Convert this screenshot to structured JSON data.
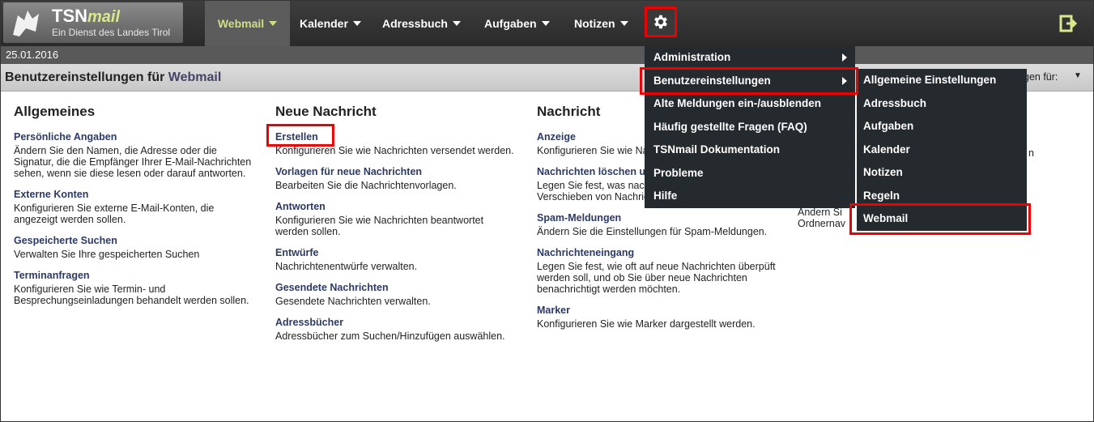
{
  "brand": {
    "name": "TSN",
    "name_suffix": "mail",
    "subtitle": "Ein Dienst des Landes Tirol"
  },
  "nav": {
    "webmail": "Webmail",
    "kalender": "Kalender",
    "adressbuch": "Adressbuch",
    "aufgaben": "Aufgaben",
    "notizen": "Notizen"
  },
  "date": "25.01.2016",
  "page_title": {
    "prefix": "Benutzereinstellungen für ",
    "app": "Webmail"
  },
  "right_partial": "gen für:",
  "columns": {
    "allgemeines": {
      "title": "Allgemeines",
      "sections": [
        {
          "h": "Persönliche Angaben",
          "d": "Ändern Sie den Namen, die Adresse oder die Signatur, die die Empfänger Ihrer E-Mail-Nachrichten sehen, wenn sie diese lesen oder darauf antworten."
        },
        {
          "h": "Externe Konten",
          "d": "Konfigurieren Sie externe E-Mail-Konten, die angezeigt werden sollen."
        },
        {
          "h": "Gespeicherte Suchen",
          "d": "Verwalten Sie Ihre gespeicherten Suchen"
        },
        {
          "h": "Terminanfragen",
          "d": "Konfigurieren Sie wie Termin- und Besprechungseinladungen behandelt werden sollen."
        }
      ]
    },
    "neue": {
      "title": "Neue Nachricht",
      "sections": [
        {
          "h": "Erstellen",
          "d": "Konfigurieren Sie wie Nachrichten versendet werden."
        },
        {
          "h": "Vorlagen für neue Nachrichten",
          "d": "Bearbeiten Sie die Nachrichtenvorlagen."
        },
        {
          "h": "Antworten",
          "d": "Konfigurieren Sie wie Nachrichten beantwortet werden sollen."
        },
        {
          "h": "Entwürfe",
          "d": "Nachrichtenentwürfe verwalten."
        },
        {
          "h": "Gesendete Nachrichten",
          "d": "Gesendete Nachrichten verwalten."
        },
        {
          "h": "Adressbücher",
          "d": "Adressbücher zum Suchen/Hinzufügen auswählen."
        }
      ]
    },
    "nachricht": {
      "title": "Nachricht",
      "sections": [
        {
          "h": "Anzeige",
          "d": "Konfigurieren Sie wie Nachrichten angezeigt werden."
        },
        {
          "h": "Nachrichten löschen und verschieben",
          "d": "Legen Sie fest, was nach dem Löschen und Verschieben von Nachrichten passieren soll."
        },
        {
          "h": "Spam-Meldungen",
          "d": "Ändern Sie die Einstellungen für Spam-Meldungen."
        },
        {
          "h": "Nachrichteneingang",
          "d": "Legen Sie fest, wie oft auf neue Nachrichten überpüft werden soll, und ob Sie über neue Nachrichten benachrichtigt werden möchten."
        },
        {
          "h": "Marker",
          "d": "Konfigurieren Sie wie Marker dargestellt werden."
        }
      ]
    },
    "partial": {
      "l1": "Ändern Si",
      "l2": "Ordnernav",
      "r1": "n"
    }
  },
  "menu1": {
    "items": [
      "Administration",
      "Benutzereinstellungen",
      "Alte Meldungen ein-/ausblenden",
      "Häufig gestellte Fragen (FAQ)",
      "TSNmail Dokumentation",
      "Probleme",
      "Hilfe"
    ]
  },
  "menu2": {
    "items": [
      "Allgemeine Einstellungen",
      "Adressbuch",
      "Aufgaben",
      "Kalender",
      "Notizen",
      "Regeln",
      "Webmail"
    ]
  },
  "colors": {
    "highlight": "#e00000",
    "menu_bg": "#252a2e",
    "topbar": "#333333"
  }
}
